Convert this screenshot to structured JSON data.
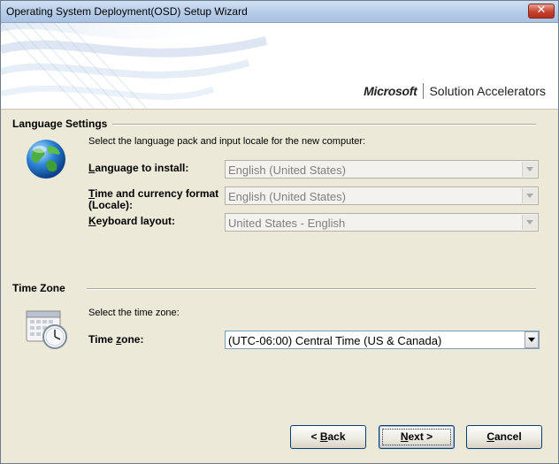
{
  "window": {
    "title": "Operating System Deployment(OSD) Setup Wizard",
    "close_glyph": "✕"
  },
  "banner": {
    "brand": "Microsoft",
    "product": "Solution Accelerators"
  },
  "language": {
    "section_title": "Language Settings",
    "prompt": "Select the language pack and input locale for the new computer:",
    "fields": {
      "language_install": {
        "label_ul": "L",
        "label_rest": "anguage to install:",
        "value": "English (United States)"
      },
      "time_currency": {
        "label_ul": "T",
        "label_rest": "ime and currency format",
        "label_line2": "(Locale):",
        "value": "English (United States)"
      },
      "keyboard": {
        "label_ul": "K",
        "label_rest": "eyboard layout:",
        "value": "United States - English"
      }
    }
  },
  "timezone": {
    "section_title": "Time Zone",
    "prompt": "Select the time zone:",
    "label_pre": "Time ",
    "label_ul": "z",
    "label_post": "one:",
    "value": "(UTC-06:00) Central Time (US & Canada)"
  },
  "buttons": {
    "back": {
      "pre": "< ",
      "ul": "B",
      "post": "ack"
    },
    "next": {
      "ul": "N",
      "post": "ext >"
    },
    "cancel": {
      "ul": "C",
      "post": "ancel"
    }
  },
  "icons": {
    "globe": "globe-icon",
    "calendar_clock": "calendar-clock-icon"
  },
  "colors": {
    "dialog_bg": "#ece9d8",
    "title_bar": "#b7cde8",
    "button_border": "#003c74"
  }
}
